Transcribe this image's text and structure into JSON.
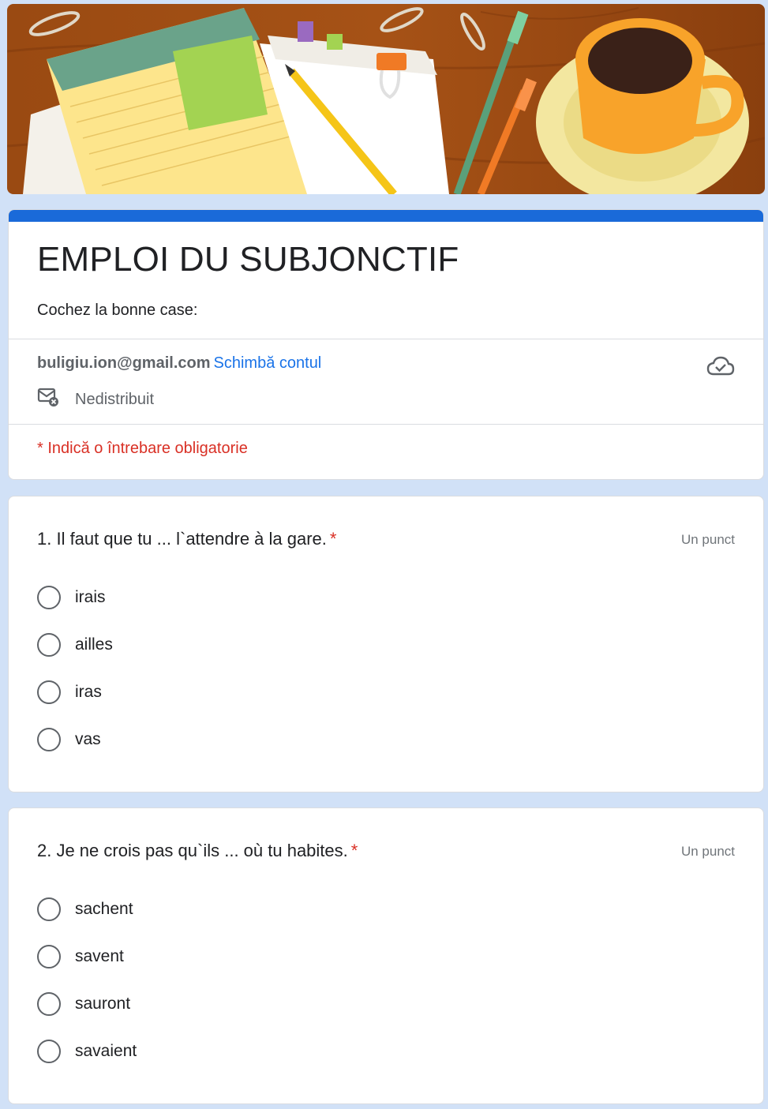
{
  "form": {
    "title": "EMPLOI DU SUBJONCTIF",
    "description": "Cochez la bonne case:",
    "account_email": "buligiu.ion@gmail.com",
    "switch_account": "Schimbă contul",
    "not_shared": "Nedistribuit",
    "required_note": "* Indică o întrebare obligatorie"
  },
  "questions": [
    {
      "title": "1. Il faut que tu ... l`attendre à la gare.",
      "required_mark": "*",
      "points": "Un punct",
      "options": [
        "irais",
        "ailles",
        "iras",
        "vas"
      ]
    },
    {
      "title": "2. Je ne crois pas qu`ils ... où tu habites.",
      "required_mark": "*",
      "points": "Un punct",
      "options": [
        "sachent",
        "savent",
        "sauront",
        "savaient"
      ]
    }
  ],
  "colors": {
    "accent": "#1a6ad9",
    "link": "#1a73e8",
    "required": "#d93025",
    "page_background": "#d1e1f7"
  },
  "icons": [
    "cloud-check-icon",
    "mail-not-shared-icon",
    "radio-unchecked-icon"
  ]
}
